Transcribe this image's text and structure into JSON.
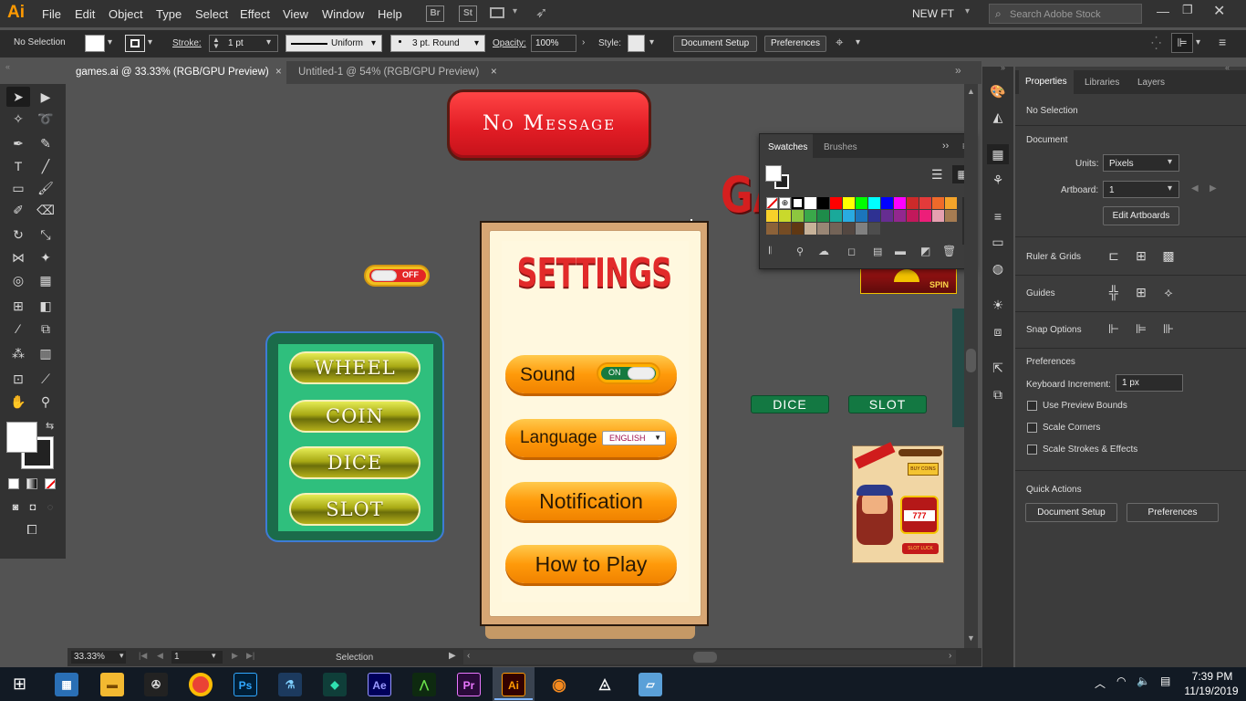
{
  "app": {
    "logo": "Ai",
    "workspace": "NEW FT",
    "search_placeholder": "Search Adobe Stock"
  },
  "menu": [
    "File",
    "Edit",
    "Object",
    "Type",
    "Select",
    "Effect",
    "View",
    "Window",
    "Help"
  ],
  "bridge": {
    "br": "Br",
    "st": "St"
  },
  "control": {
    "selection": "No Selection",
    "stroke_label": "Stroke:",
    "stroke_value": "1 pt",
    "profile": "Uniform",
    "brush": "3 pt. Round",
    "opacity_label": "Opacity:",
    "opacity_value": "100%",
    "style_label": "Style:",
    "doc_setup": "Document Setup",
    "preferences": "Preferences"
  },
  "doc_tabs": [
    {
      "label": "games.ai @ 33.33% (RGB/GPU Preview)"
    },
    {
      "label": "Untitled-1 @ 54% (RGB/GPU Preview)"
    }
  ],
  "artwork": {
    "no_message": "No Message",
    "toggle_off": "OFF",
    "settings_title": "SETTINGS",
    "sound": "Sound",
    "toggle_on": "ON",
    "language": "Language",
    "english": "ENGLISH",
    "notification": "Notification",
    "how_to_play": "How to Play",
    "menu_buttons": [
      "WHEEL",
      "COIN",
      "DICE",
      "SLOT"
    ],
    "dice": "DICE",
    "slot": "SLOT",
    "ga": "GA",
    "spin": "SPIN",
    "thumb_buy": "BUY COINS",
    "thumb_slot": "SLOT LUCK"
  },
  "swatches": {
    "tab_swatches": "Swatches",
    "tab_brushes": "Brushes",
    "colors": [
      "#ffffff",
      "#000000",
      "#ff0000",
      "#ffff00",
      "#00ff00",
      "#00ffff",
      "#0000ff",
      "#ff00ff",
      "#cc2a2a",
      "#e33a3a",
      "#ef6a2a",
      "#f4a42a",
      "#f7d02a",
      "#c9d92c",
      "#8dc63f",
      "#3aa84a",
      "#1e8c4a",
      "#1aa99a",
      "#29abe2",
      "#1b75bc",
      "#2e3192",
      "#662d91",
      "#92278f",
      "#c2185b",
      "#ed1e79",
      "#e6a0b0",
      "#a67c52",
      "#8c6239",
      "#754c24",
      "#603813",
      "#c7b299",
      "#998675",
      "#736357",
      "#534741",
      "#808080",
      "#4d4d4d"
    ]
  },
  "status": {
    "zoom": "33.33%",
    "page": "1",
    "tool": "Selection"
  },
  "panel": {
    "tabs": [
      "Properties",
      "Libraries",
      "Layers"
    ],
    "no_selection": "No Selection",
    "document": "Document",
    "units_label": "Units:",
    "units_value": "Pixels",
    "artboard_label": "Artboard:",
    "artboard_value": "1",
    "edit_artboards": "Edit Artboards",
    "rulers": "Ruler & Grids",
    "guides": "Guides",
    "snap": "Snap Options",
    "preferences": "Preferences",
    "keyboard_label": "Keyboard Increment:",
    "keyboard_value": "1 px",
    "use_preview": "Use Preview Bounds",
    "scale_corners": "Scale Corners",
    "scale_strokes": "Scale Strokes & Effects",
    "quick_actions": "Quick Actions",
    "doc_setup": "Document Setup",
    "prefs_btn": "Preferences"
  },
  "taskbar": {
    "apps": [
      "Ps",
      "Ae",
      "Pr",
      "Ai"
    ],
    "time": "7:39 PM",
    "date": "11/19/2019"
  }
}
